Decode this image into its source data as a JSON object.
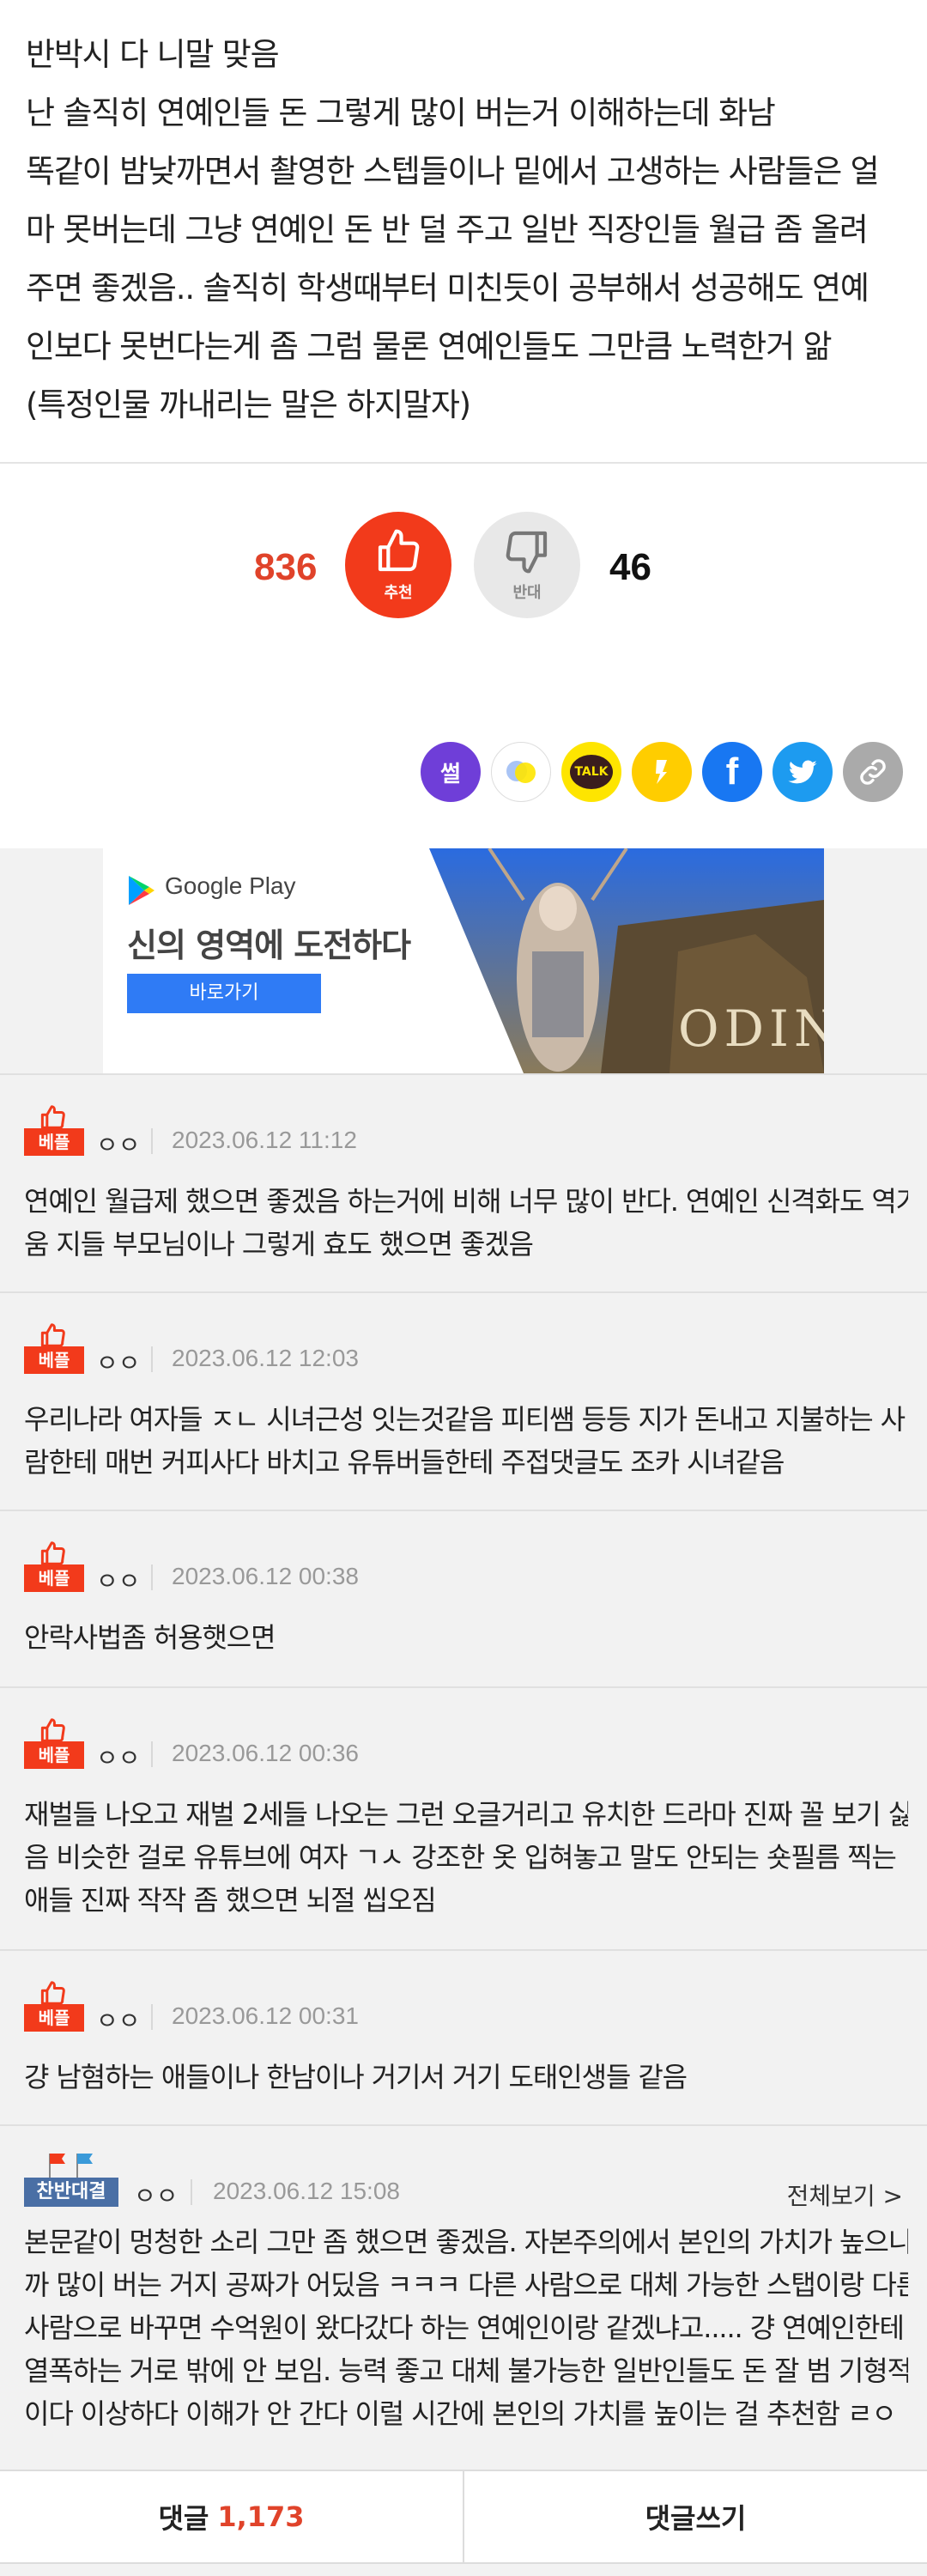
{
  "post": {
    "lines": [
      "반박시 다 니말 맞음",
      "난 솔직히 연예인들 돈 그렇게 많이 버는거 이해하는데 화남",
      "똑같이 밤낮까면서 촬영한 스텝들이나 밑에서 고생하는 사람들은 얼",
      "마 못버는데 그냥 연예인 돈 반 덜 주고 일반 직장인들 월급 좀 올려",
      "주면 좋겠음.. 솔직히 학생때부터 미친듯이 공부해서 성공해도 연예",
      "인보다 못번다는게 좀 그럼 물론 연예인들도 그만큼 노력한거 앎",
      "(특정인물 까내리는 말은 하지말자)"
    ]
  },
  "vote": {
    "up_count": "836",
    "up_label": "추천",
    "down_count": "46",
    "down_label": "반대"
  },
  "share": {
    "ssul_label": "썰",
    "talk_label": "TALK",
    "fb_label": "f"
  },
  "ad": {
    "store_name": "Google Play",
    "headline": "신의 영역에 도전하다",
    "cta": "바로가기",
    "game_logo": "ODIN"
  },
  "comments": [
    {
      "badge": "베플",
      "author": "ㅇㅇ",
      "date": "2023.06.12 11:12",
      "lines": [
        "연예인 월급제 했으면 좋겠음 하는거에 비해 너무 많이 반다. 연예인 신격화도 역겨",
        "움 지들 부모님이나 그렇게 효도 했으면 좋겠음"
      ]
    },
    {
      "badge": "베플",
      "author": "ㅇㅇ",
      "date": "2023.06.12 12:03",
      "lines": [
        "우리나라 여자들 ㅈㄴ 시녀근성 잇는것같음 피티쌤 등등 지가 돈내고 지불하는 사",
        "람한테 매번 커피사다 바치고 유튜버들한테 주접댓글도 조카 시녀같음"
      ]
    },
    {
      "badge": "베플",
      "author": "ㅇㅇ",
      "date": "2023.06.12 00:38",
      "lines": [
        "안락사법좀 허용햇으면"
      ]
    },
    {
      "badge": "베플",
      "author": "ㅇㅇ",
      "date": "2023.06.12 00:36",
      "lines": [
        "재벌들 나오고 재벌 2세들 나오는 그런 오글거리고 유치한 드라마 진짜 꼴 보기 싫",
        "음 비슷한 걸로 유튜브에 여자 ㄱㅅ 강조한 옷 입혀놓고 말도 안되는 숏필름 찍는",
        "애들 진짜 작작 좀 했으면 뇌절 씹오짐"
      ]
    },
    {
      "badge": "베플",
      "author": "ㅇㅇ",
      "date": "2023.06.12 00:31",
      "lines": [
        "걍 남혐하는 애들이나 한남이나 거기서 거기 도태인생들 같음"
      ]
    }
  ],
  "debate": {
    "badge": "찬반대결",
    "author": "ㅇㅇ",
    "date": "2023.06.12 15:08",
    "view_all": "전체보기 >",
    "lines": [
      "본문같이 멍청한 소리 그만 좀 했으면 좋겠음. 자본주의에서 본인의 가치가 높으니",
      "까 많이 버는 거지 공짜가 어딨음 ㅋㅋㅋ 다른 사람으로 대체 가능한 스탭이랑 다른",
      "사람으로 바꾸면 수억원이 왔다갔다 하는 연예인이랑 같겠냐고..... 걍 연예인한테",
      "열폭하는 거로 밖에 안 보임. 능력 좋고 대체 불가능한 일반인들도 돈 잘 범 기형적",
      "이다 이상하다 이해가 안 간다 이럴 시간에 본인의 가치를 높이는 걸 추천함 ㄹㅇ"
    ]
  },
  "bottom": {
    "comments_label": "댓글",
    "comments_count": "1,173",
    "write_label": "댓글쓰기"
  },
  "colors": {
    "accent_red": "#f23a1b",
    "count_red": "#e0432a",
    "debate_blue": "#4a6fa5"
  }
}
